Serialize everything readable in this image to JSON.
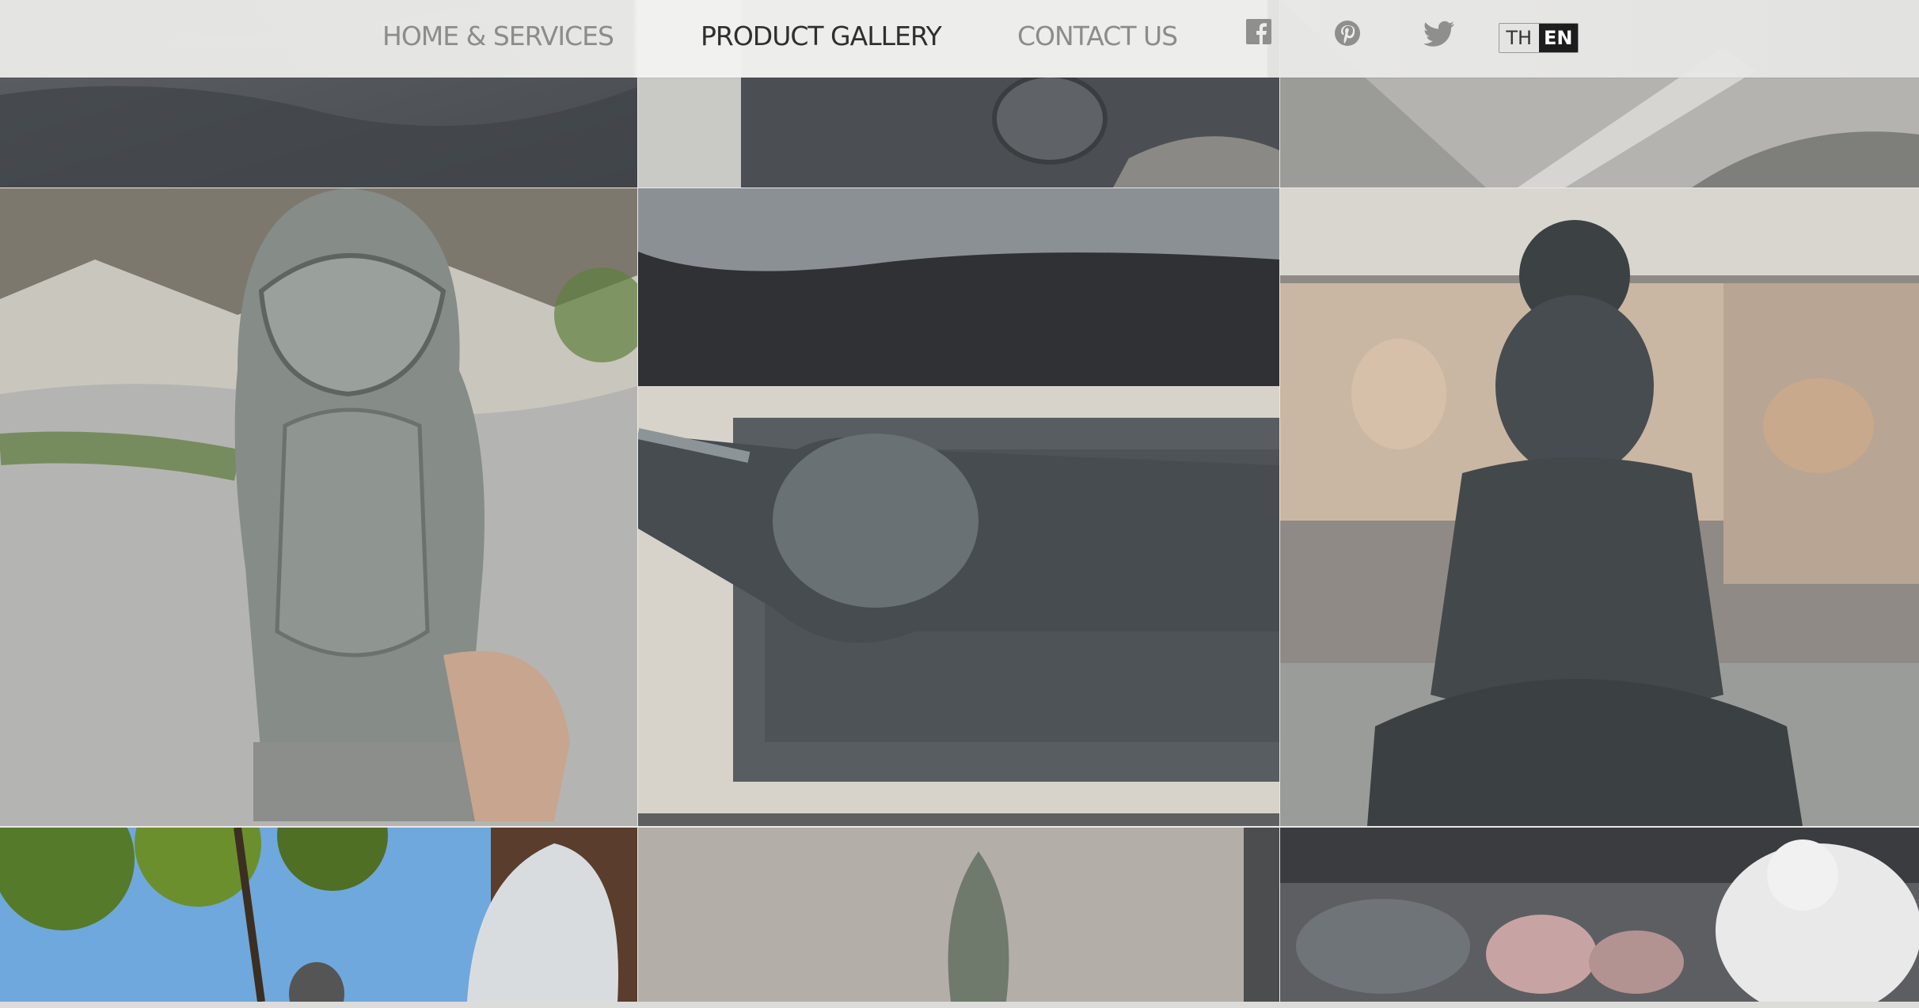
{
  "nav": {
    "home": "HOME  &  SERVICES",
    "gallery": "PRODUCT  GALLERY",
    "contact": "CONTACT  US"
  },
  "social": [
    "facebook-icon",
    "pinterest-icon",
    "twitter-icon"
  ],
  "language": {
    "th": "TH",
    "en": "EN",
    "selected": "EN"
  },
  "colors": {
    "nav_inactive": "#8c8c8c",
    "nav_active": "#2f2f2f",
    "lang_active_bg": "#1d1d1d"
  },
  "gallery": {
    "tiles": [
      "granite-slab-top-left",
      "stone-carving-top-center",
      "sand-stone-top-right",
      "singha-lion-statue",
      "reclining-buddha-head",
      "seated-buddha-statue",
      "naga-statue-under-tree",
      "lotus-flame-finial",
      "laughing-buddha-statues"
    ]
  }
}
